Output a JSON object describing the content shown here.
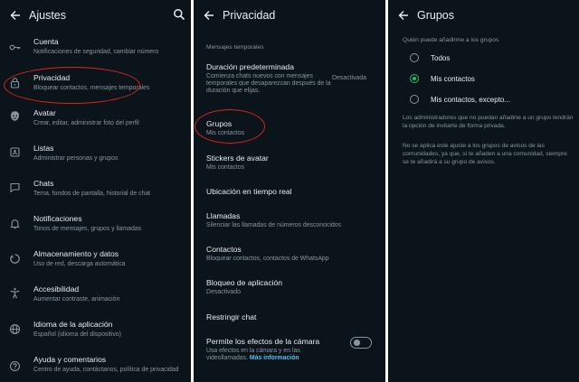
{
  "panel1": {
    "title": "Ajustes",
    "items": [
      {
        "icon": "key-icon",
        "title": "Cuenta",
        "subtitle": "Notificaciones de seguridad, cambiar número"
      },
      {
        "icon": "lock-icon",
        "title": "Privacidad",
        "subtitle": "Bloquear contactos, mensajes temporales"
      },
      {
        "icon": "avatar-face-icon",
        "title": "Avatar",
        "subtitle": "Crear, editar, administrar foto del perfil"
      },
      {
        "icon": "list-icon",
        "title": "Listas",
        "subtitle": "Administrar personas y grupos"
      },
      {
        "icon": "chat-icon",
        "title": "Chats",
        "subtitle": "Tema, fondos de pantalla, historial de chat"
      },
      {
        "icon": "bell-icon",
        "title": "Notificaciones",
        "subtitle": "Tonos de mensajes, grupos y llamadas"
      },
      {
        "icon": "storage-icon",
        "title": "Almacenamiento y datos",
        "subtitle": "Uso de red, descarga automática"
      },
      {
        "icon": "accessibility-icon",
        "title": "Accesibilidad",
        "subtitle": "Aumentar contraste, animación"
      },
      {
        "icon": "globe-icon",
        "title": "Idioma de la aplicación",
        "subtitle": "Español (idioma del dispositivo)"
      },
      {
        "icon": "help-icon",
        "title": "Ayuda y comentarios",
        "subtitle": "Centro de ayuda, contáctanos, política de privacidad"
      }
    ]
  },
  "panel2": {
    "title": "Privacidad",
    "section": "Mensajes temporales",
    "duration": {
      "title": "Duración predeterminada",
      "subtitle": "Comienza chats nuevos con mensajes temporales que desaparezcan después de la duración que elijas.",
      "value": "Desactivada"
    },
    "items": [
      {
        "title": "Grupos",
        "subtitle": "Mis contactos"
      },
      {
        "title": "Stickers de avatar",
        "subtitle": "Mis contactos"
      },
      {
        "title": "Ubicación en tiempo real",
        "subtitle": ""
      },
      {
        "title": "Llamadas",
        "subtitle": "Silenciar las llamadas de números desconocidos"
      },
      {
        "title": "Contactos",
        "subtitle": "Bloquear contactos, contactos de WhatsApp"
      },
      {
        "title": "Bloqueo de aplicación",
        "subtitle": "Desactivado"
      },
      {
        "title": "Restringir chat",
        "subtitle": ""
      }
    ],
    "camera": {
      "title": "Permite los efectos de la cámara",
      "subtitle": "Usa efectos en la cámara y en las videollamadas.",
      "link": "Más información",
      "toggle_on": false
    }
  },
  "panel3": {
    "title": "Grupos",
    "question": "Quién puede añadirme a los grupos",
    "options": [
      {
        "label": "Todos",
        "selected": false
      },
      {
        "label": "Mis contactos",
        "selected": true
      },
      {
        "label": "Mis contactos, excepto...",
        "selected": false
      }
    ],
    "note1": "Los administradores que no puedan añadirte a un grupo tendrán la opción de invitarte de forma privada.",
    "note2": "No se aplica este ajuste a los grupos de avisos de las comunidades, ya que, si te añaden a una comunidad, siempre se te añadirá a su grupo de avisos."
  },
  "colors": {
    "background": "#0b141a",
    "text_primary": "#e9edef",
    "text_secondary": "#8696a0",
    "accent_green": "#21c063",
    "link_blue": "#53bdeb",
    "highlight_red": "#e2231a"
  }
}
